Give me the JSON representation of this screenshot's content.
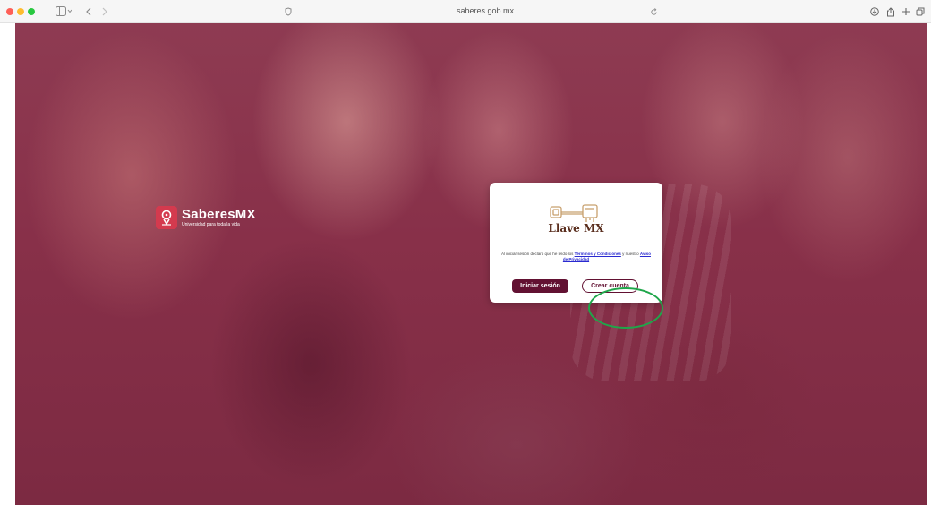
{
  "browser": {
    "url": "saberes.gob.mx"
  },
  "page": {
    "logo": {
      "title_left": "Saberes",
      "title_right": "MX",
      "tagline": "Universidad para toda la vida"
    },
    "modal": {
      "brand": "Llave MX",
      "terms_prefix": "Al iniciar sesión declaro que he leído los ",
      "terms_link": "Términos y Condiciones",
      "terms_middle": " y nuestro ",
      "privacy_link": "Aviso de Privacidad",
      "login_label": "Iniciar sesión",
      "create_label": "Crear cuenta"
    },
    "colors": {
      "primary": "#621132",
      "overlay": "#883049",
      "highlight": "#1fa64a",
      "badge": "#d43a4e"
    }
  }
}
